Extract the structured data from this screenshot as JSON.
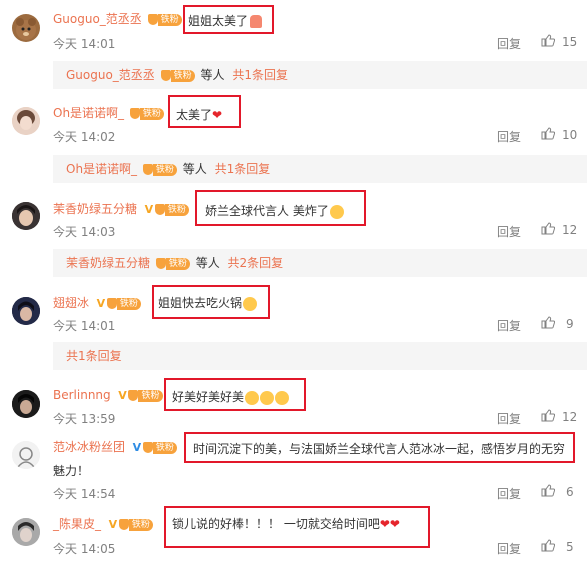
{
  "comments": [
    {
      "name": "Guoguo_范丞丞",
      "text": "姐姐太美了",
      "emoji": "cake",
      "time": "今天 14:01",
      "reply": "回复",
      "likes": "15",
      "sub": {
        "name": "Guoguo_范丞丞",
        "etc": "等人",
        "count": "共1条回复"
      }
    },
    {
      "name": "Oh是诺诺啊_",
      "text": "太美了",
      "emoji": "heart",
      "time": "今天 14:02",
      "reply": "回复",
      "likes": "10",
      "sub": {
        "name": "Oh是诺诺啊_",
        "etc": "等人",
        "count": "共1条回复"
      }
    },
    {
      "name": "茉香奶绿五分糖",
      "text": "娇兰全球代言人 美炸了",
      "emoji": "surprised-face",
      "time": "今天 14:03",
      "reply": "回复",
      "likes": "12",
      "sub": {
        "name": "茉香奶绿五分糖",
        "etc": "等人",
        "count": "共2条回复"
      }
    },
    {
      "name": "翅翅冰",
      "text": "姐姐快去吃火锅",
      "emoji": "scream-face",
      "time": "今天 14:01",
      "reply": "回复",
      "likes": "9",
      "sub": {
        "count": "共1条回复"
      }
    },
    {
      "name": "Berlinnng",
      "text": "好美好美好美",
      "emoji": "laugh-face",
      "time": "今天 13:59",
      "reply": "回复",
      "likes": "12"
    },
    {
      "name": "范冰冰粉丝团",
      "text": "时间沉淀下的美，与法国娇兰全球代言人范冰冰一起，感悟岁月的无穷",
      "text2": "魅力！",
      "time": "今天 14:54",
      "reply": "回复",
      "likes": "6"
    },
    {
      "name": "_陈果皮_",
      "text": "锁儿说的好棒！！！ 一切就交给时间吧",
      "emoji": "heart",
      "time": "今天 14:05",
      "reply": "回复",
      "likes": "5"
    }
  ],
  "badge_label": "铁粉",
  "colors": {
    "name": "#eb7350",
    "highlight": "#e2182a",
    "muted": "#808080"
  }
}
